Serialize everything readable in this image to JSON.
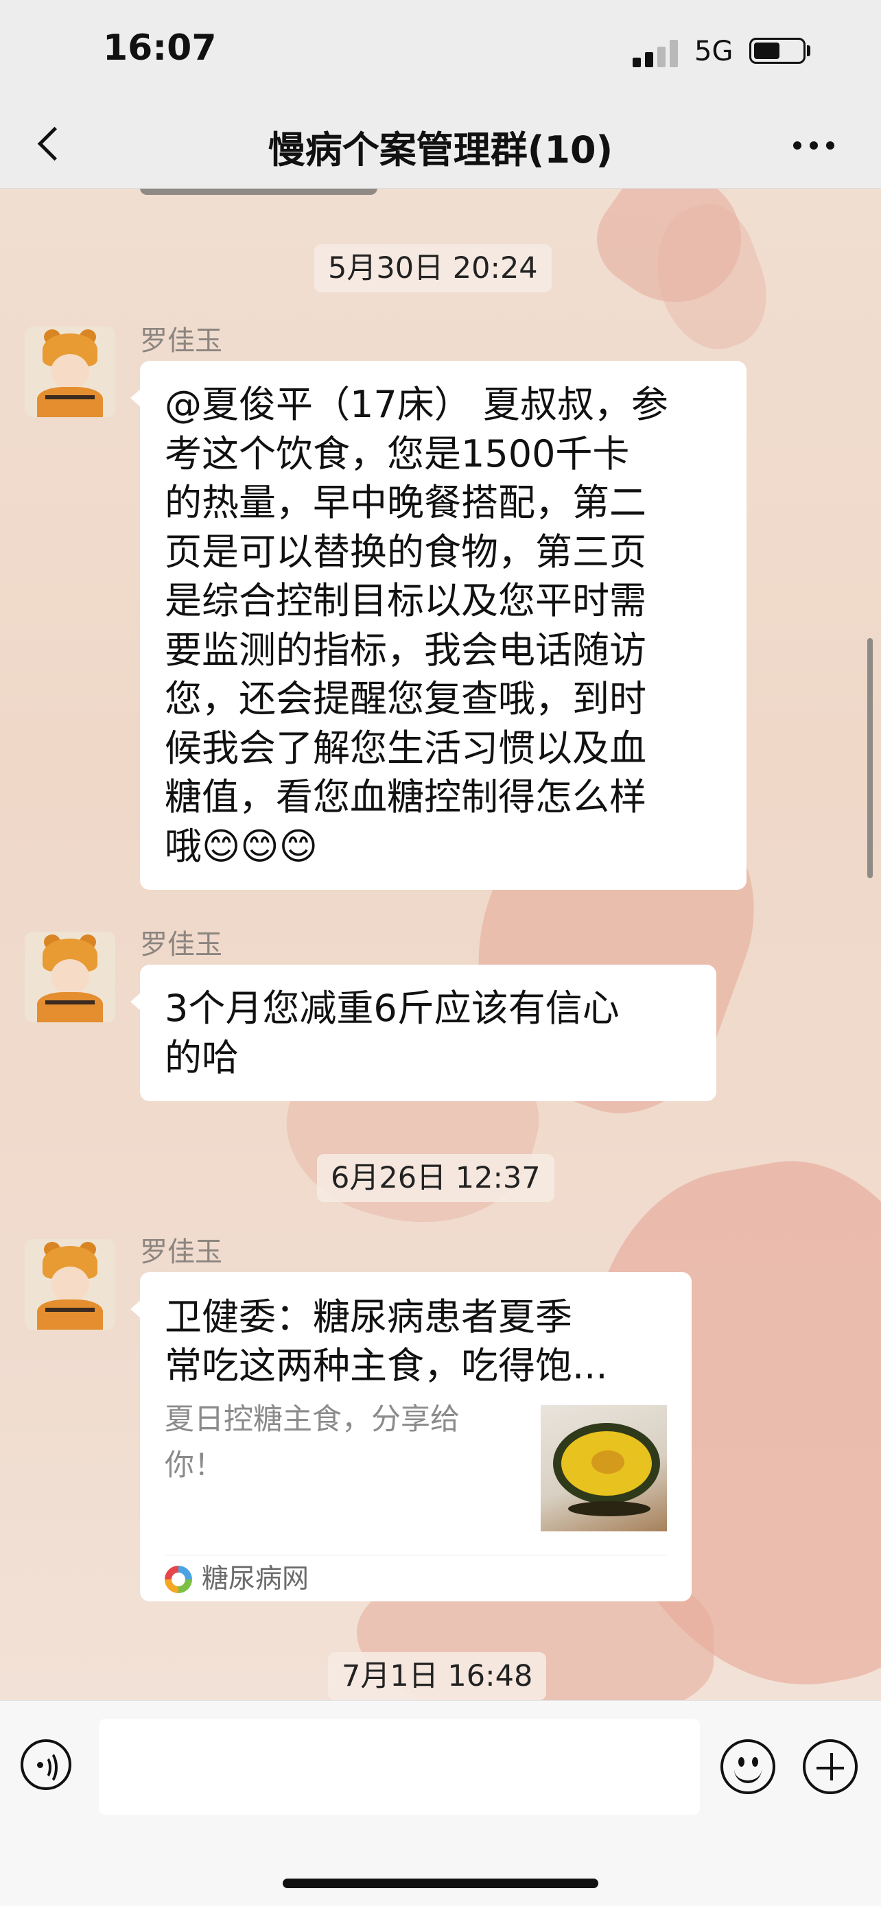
{
  "status_bar": {
    "time": "16:07",
    "network": "5G",
    "signal_bars": 4,
    "signal_bars_filled": 2,
    "battery_level": 0.55
  },
  "nav": {
    "title": "慢病个案管理群(10)"
  },
  "messages": [
    {
      "timestamp": "5月30日 20:24",
      "sender": "罗佳玉",
      "lines": [
        "@夏俊平（17床） 夏叔叔，参",
        "考这个饮食，您是1500千卡",
        "的热量，早中晚餐搭配，第二",
        "页是可以替换的食物，第三页",
        "是综合控制目标以及您平时需",
        "要监测的指标，我会电话随访",
        "您，还会提醒您复查哦，到时",
        "候我会了解您生活习惯以及血",
        "糖值，看您血糖控制得怎么样",
        "哦😊😊😊"
      ]
    },
    {
      "sender": "罗佳玉",
      "lines": [
        "3个月您减重6斤应该有信心",
        "的哈"
      ]
    },
    {
      "timestamp": "6月26日 12:37",
      "sender": "罗佳玉",
      "link_card": {
        "title_lines": [
          "卫健委：糖尿病患者夏季",
          "常吃这两种主食，吃得饱..."
        ],
        "desc_lines": [
          "夏日控糖主食，分享给",
          "你！"
        ],
        "thumbnail": "pumpkin-image",
        "source": "糖尿病网"
      }
    },
    {
      "timestamp": "7月1日 16:48"
    }
  ],
  "input_bar": {
    "voice_icon": "voice-icon",
    "emoji_icon": "emoji-icon",
    "plus_icon": "plus-icon",
    "input_value": ""
  }
}
